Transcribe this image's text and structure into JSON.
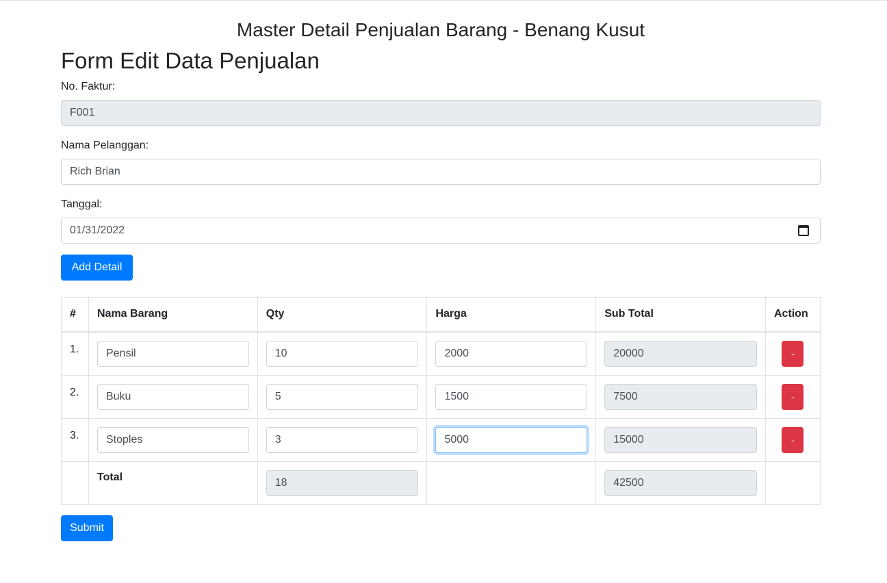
{
  "page_title": "Master Detail Penjualan Barang - Benang Kusut",
  "form_title": "Form Edit Data Penjualan",
  "fields": {
    "faktur": {
      "label": "No. Faktur:",
      "value": "F001"
    },
    "pelanggan": {
      "label": "Nama Pelanggan:",
      "value": "Rich Brian"
    },
    "tanggal": {
      "label": "Tanggal:",
      "value": "01/31/2022"
    }
  },
  "add_detail_label": "Add Detail",
  "table": {
    "headers": {
      "num": "#",
      "nama": "Nama Barang",
      "qty": "Qty",
      "harga": "Harga",
      "subtotal": "Sub Total",
      "action": "Action"
    },
    "rows": [
      {
        "num": "1.",
        "nama": "Pensil",
        "qty": "10",
        "harga": "2000",
        "subtotal": "20000",
        "action": "-"
      },
      {
        "num": "2.",
        "nama": "Buku",
        "qty": "5",
        "harga": "1500",
        "subtotal": "7500",
        "action": "-"
      },
      {
        "num": "3.",
        "nama": "Stoples",
        "qty": "3",
        "harga": "5000",
        "subtotal": "15000",
        "action": "-"
      }
    ],
    "total": {
      "label": "Total",
      "qty": "18",
      "subtotal": "42500"
    }
  },
  "submit_label": "Submit",
  "colors": {
    "primary": "#007bff",
    "danger": "#dc3545",
    "readonly_bg": "#e9ecef"
  },
  "icons": {
    "date": "calendar-icon"
  }
}
